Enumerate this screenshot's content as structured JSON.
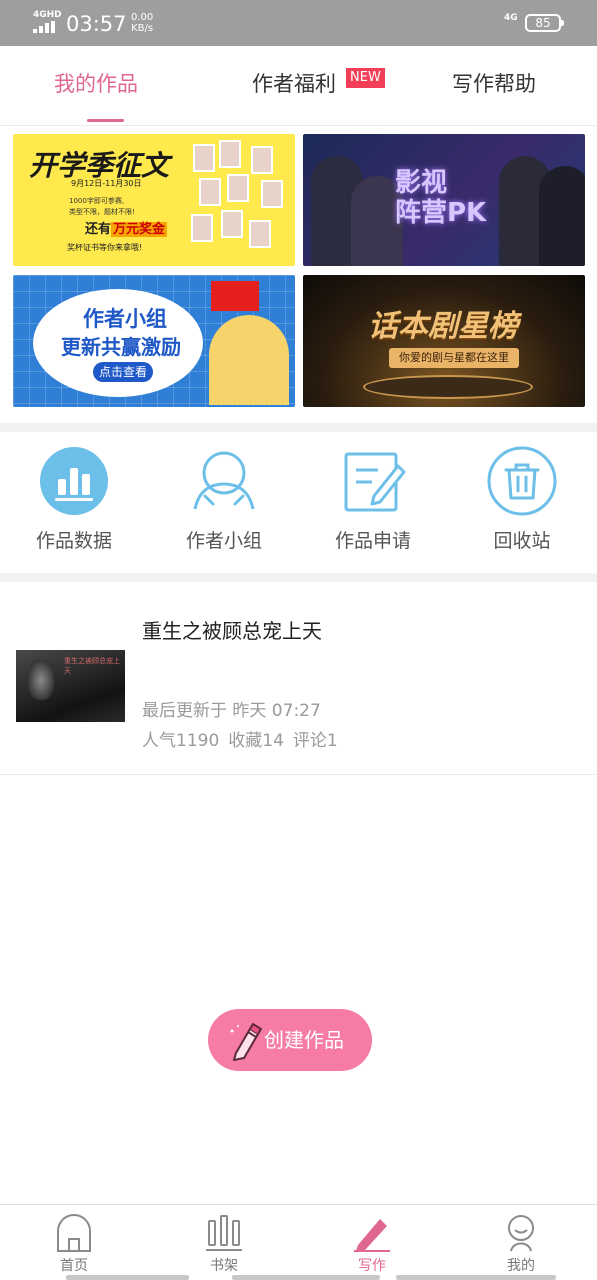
{
  "status_bar": {
    "network": "4GHD",
    "time": "03:57",
    "speed_value": "0.00",
    "speed_unit": "KB/s",
    "network_right": "4G",
    "battery": "85"
  },
  "tabs": [
    {
      "label": "我的作品",
      "active": true
    },
    {
      "label": "作者福利",
      "active": false,
      "badge": "NEW"
    },
    {
      "label": "写作帮助",
      "active": false
    }
  ],
  "banners": {
    "b1": {
      "title": "开学季征文",
      "dates": "9月12日-11月30日",
      "line1": "1000字即可参赛,",
      "line2": "类型不限，题材不限!",
      "prize_prefix": "还有",
      "prize": "万元奖金",
      "footer": "奖杯证书等你来拿哦!"
    },
    "b2": {
      "title_line1": "影视",
      "title_line2": "阵营PK"
    },
    "b3": {
      "title_line1": "作者小组",
      "title_line2": "更新共赢激励",
      "button": "点击查看"
    },
    "b4": {
      "title": "话本剧星榜",
      "subtitle": "你爱的剧与星都在这里"
    }
  },
  "shortcuts": [
    {
      "label": "作品数据",
      "icon": "bar-chart-icon"
    },
    {
      "label": "作者小组",
      "icon": "group-icon"
    },
    {
      "label": "作品申请",
      "icon": "edit-note-icon"
    },
    {
      "label": "回收站",
      "icon": "trash-icon"
    }
  ],
  "works": [
    {
      "title": "重生之被顾总宠上天",
      "updated": "最后更新于 昨天 07:27",
      "popularity": "人气1190",
      "favorites": "收藏14",
      "comments": "评论1"
    }
  ],
  "create_button": "创建作品",
  "bottom_nav": [
    {
      "label": "首页",
      "icon": "home-icon",
      "active": false
    },
    {
      "label": "书架",
      "icon": "bookshelf-icon",
      "active": false
    },
    {
      "label": "写作",
      "icon": "pen-icon",
      "active": true
    },
    {
      "label": "我的",
      "icon": "profile-icon",
      "active": false
    }
  ],
  "colors": {
    "accent": "#e0678f",
    "create_button": "#f67ba6",
    "badge": "#f23e56",
    "icon_blue": "#6cbfe8"
  }
}
